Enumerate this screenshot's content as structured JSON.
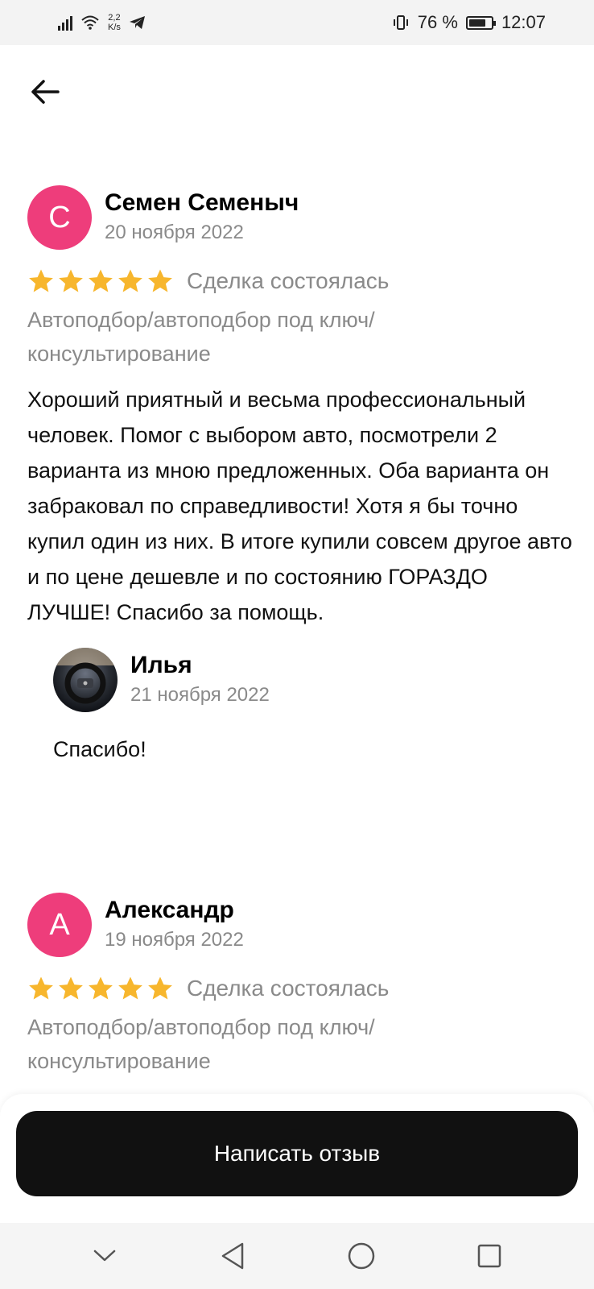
{
  "status_bar": {
    "net_speed_value": "2,2",
    "net_speed_unit": "K/s",
    "battery": "76 %",
    "battery_level": 0.76,
    "time": "12:07"
  },
  "icons": {
    "back": "arrow-left-icon",
    "star": "star-icon",
    "nav_down": "chevron-down-icon",
    "nav_back": "triangle-back-icon",
    "nav_home": "circle-home-icon",
    "nav_recent": "square-recent-icon"
  },
  "colors": {
    "avatar": "#ee3d7b",
    "star": "#f7b62d",
    "muted_text": "#8a8a8a",
    "button_bg": "#111111"
  },
  "reviews": [
    {
      "avatar_letter": "С",
      "author": "Семен Семеныч",
      "date": "20 ноября 2022",
      "rating": 5,
      "deal_status": "Сделка состоялась",
      "category": "Автоподбор/автоподбор под ключ/\nконсультирование",
      "text": "Хороший приятный и весьма профессиональный человек. Помог с выбором авто, посмотрели 2 варианта из мною предложенных. Оба варианта он забраковал по справедливости! Хотя я бы точно купил один из них. В итоге купили совсем другое авто и по цене дешевле и по состоянию ГОРАЗДО ЛУЧШЕ! Спасибо за помощь.",
      "reply": {
        "author": "Илья",
        "date": "21 ноября 2022",
        "text": "Спасибо!"
      }
    },
    {
      "avatar_letter": "А",
      "author": "Александр",
      "date": "19 ноября 2022",
      "rating": 5,
      "deal_status": "Сделка состоялась",
      "category": "Автоподбор/автоподбор под ключ/\nконсультирование"
    }
  ],
  "write_review_label": "Написать отзыв"
}
